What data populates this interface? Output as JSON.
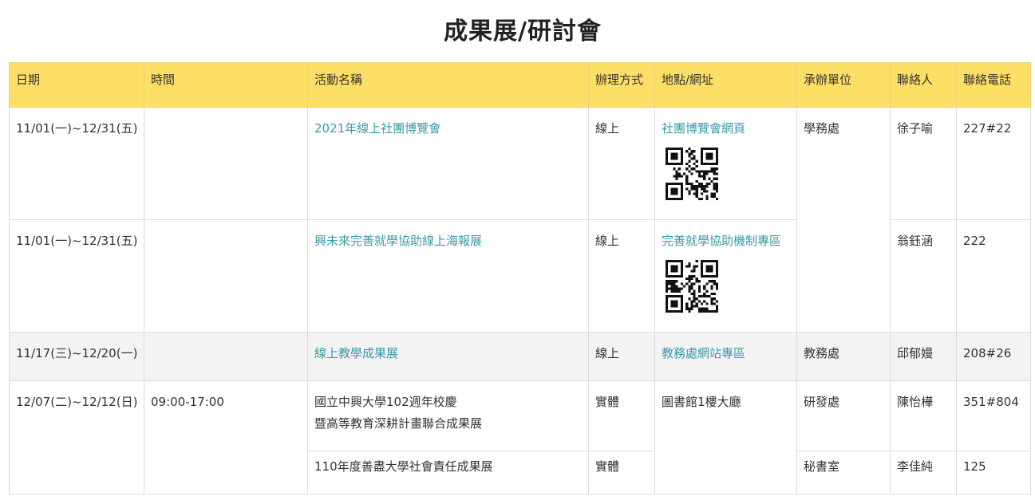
{
  "title": "成果展/研討會",
  "colors": {
    "header_bg": "#fddf65",
    "link": "#3a9aa8",
    "stripe": "#f3f3f3"
  },
  "headers": [
    "日期",
    "時間",
    "活動名稱",
    "辦理方式",
    "地點/網址",
    "承辦單位",
    "聯絡人",
    "聯絡電話"
  ],
  "rows": [
    {
      "date": "11/01(一)~12/31(五)",
      "time": "",
      "name": "2021年線上社團博覽會",
      "mode": "線上",
      "location": "社團博覽會網頁",
      "unit": "學務處",
      "contact": "徐子喻",
      "phone": "227#22"
    },
    {
      "date": "11/01(一)~12/31(五)",
      "time": "",
      "name": "興未來完善就學協助線上海報展",
      "mode": "線上",
      "location": "完善就學協助機制專區",
      "unit": "學務處",
      "contact": "翁鈺涵",
      "phone": "222"
    },
    {
      "date": "11/17(三)~12/20(一)",
      "time": "",
      "name": "線上教學成果展",
      "mode": "線上",
      "location": "教務處網站專區",
      "unit": "教務處",
      "contact": "邱郁嫚",
      "phone": "208#26"
    },
    {
      "date": "12/07(二)~12/12(日)",
      "time": "09:00-17:00",
      "name_lines": [
        "國立中興大學102週年校慶",
        "暨高等教育深耕計畫聯合成果展"
      ],
      "mode": "實體",
      "location": "圖書館1樓大廳",
      "unit": "研發處",
      "contact": "陳怡樺",
      "phone": "351#804"
    },
    {
      "date": "12/07(二)~12/12(日)",
      "time": "09:00-17:00",
      "name": "110年度善盡大學社會責任成果展",
      "mode": "實體",
      "location": "圖書館1樓大廳",
      "unit": "秘書室",
      "contact": "李佳純",
      "phone": "125"
    }
  ]
}
